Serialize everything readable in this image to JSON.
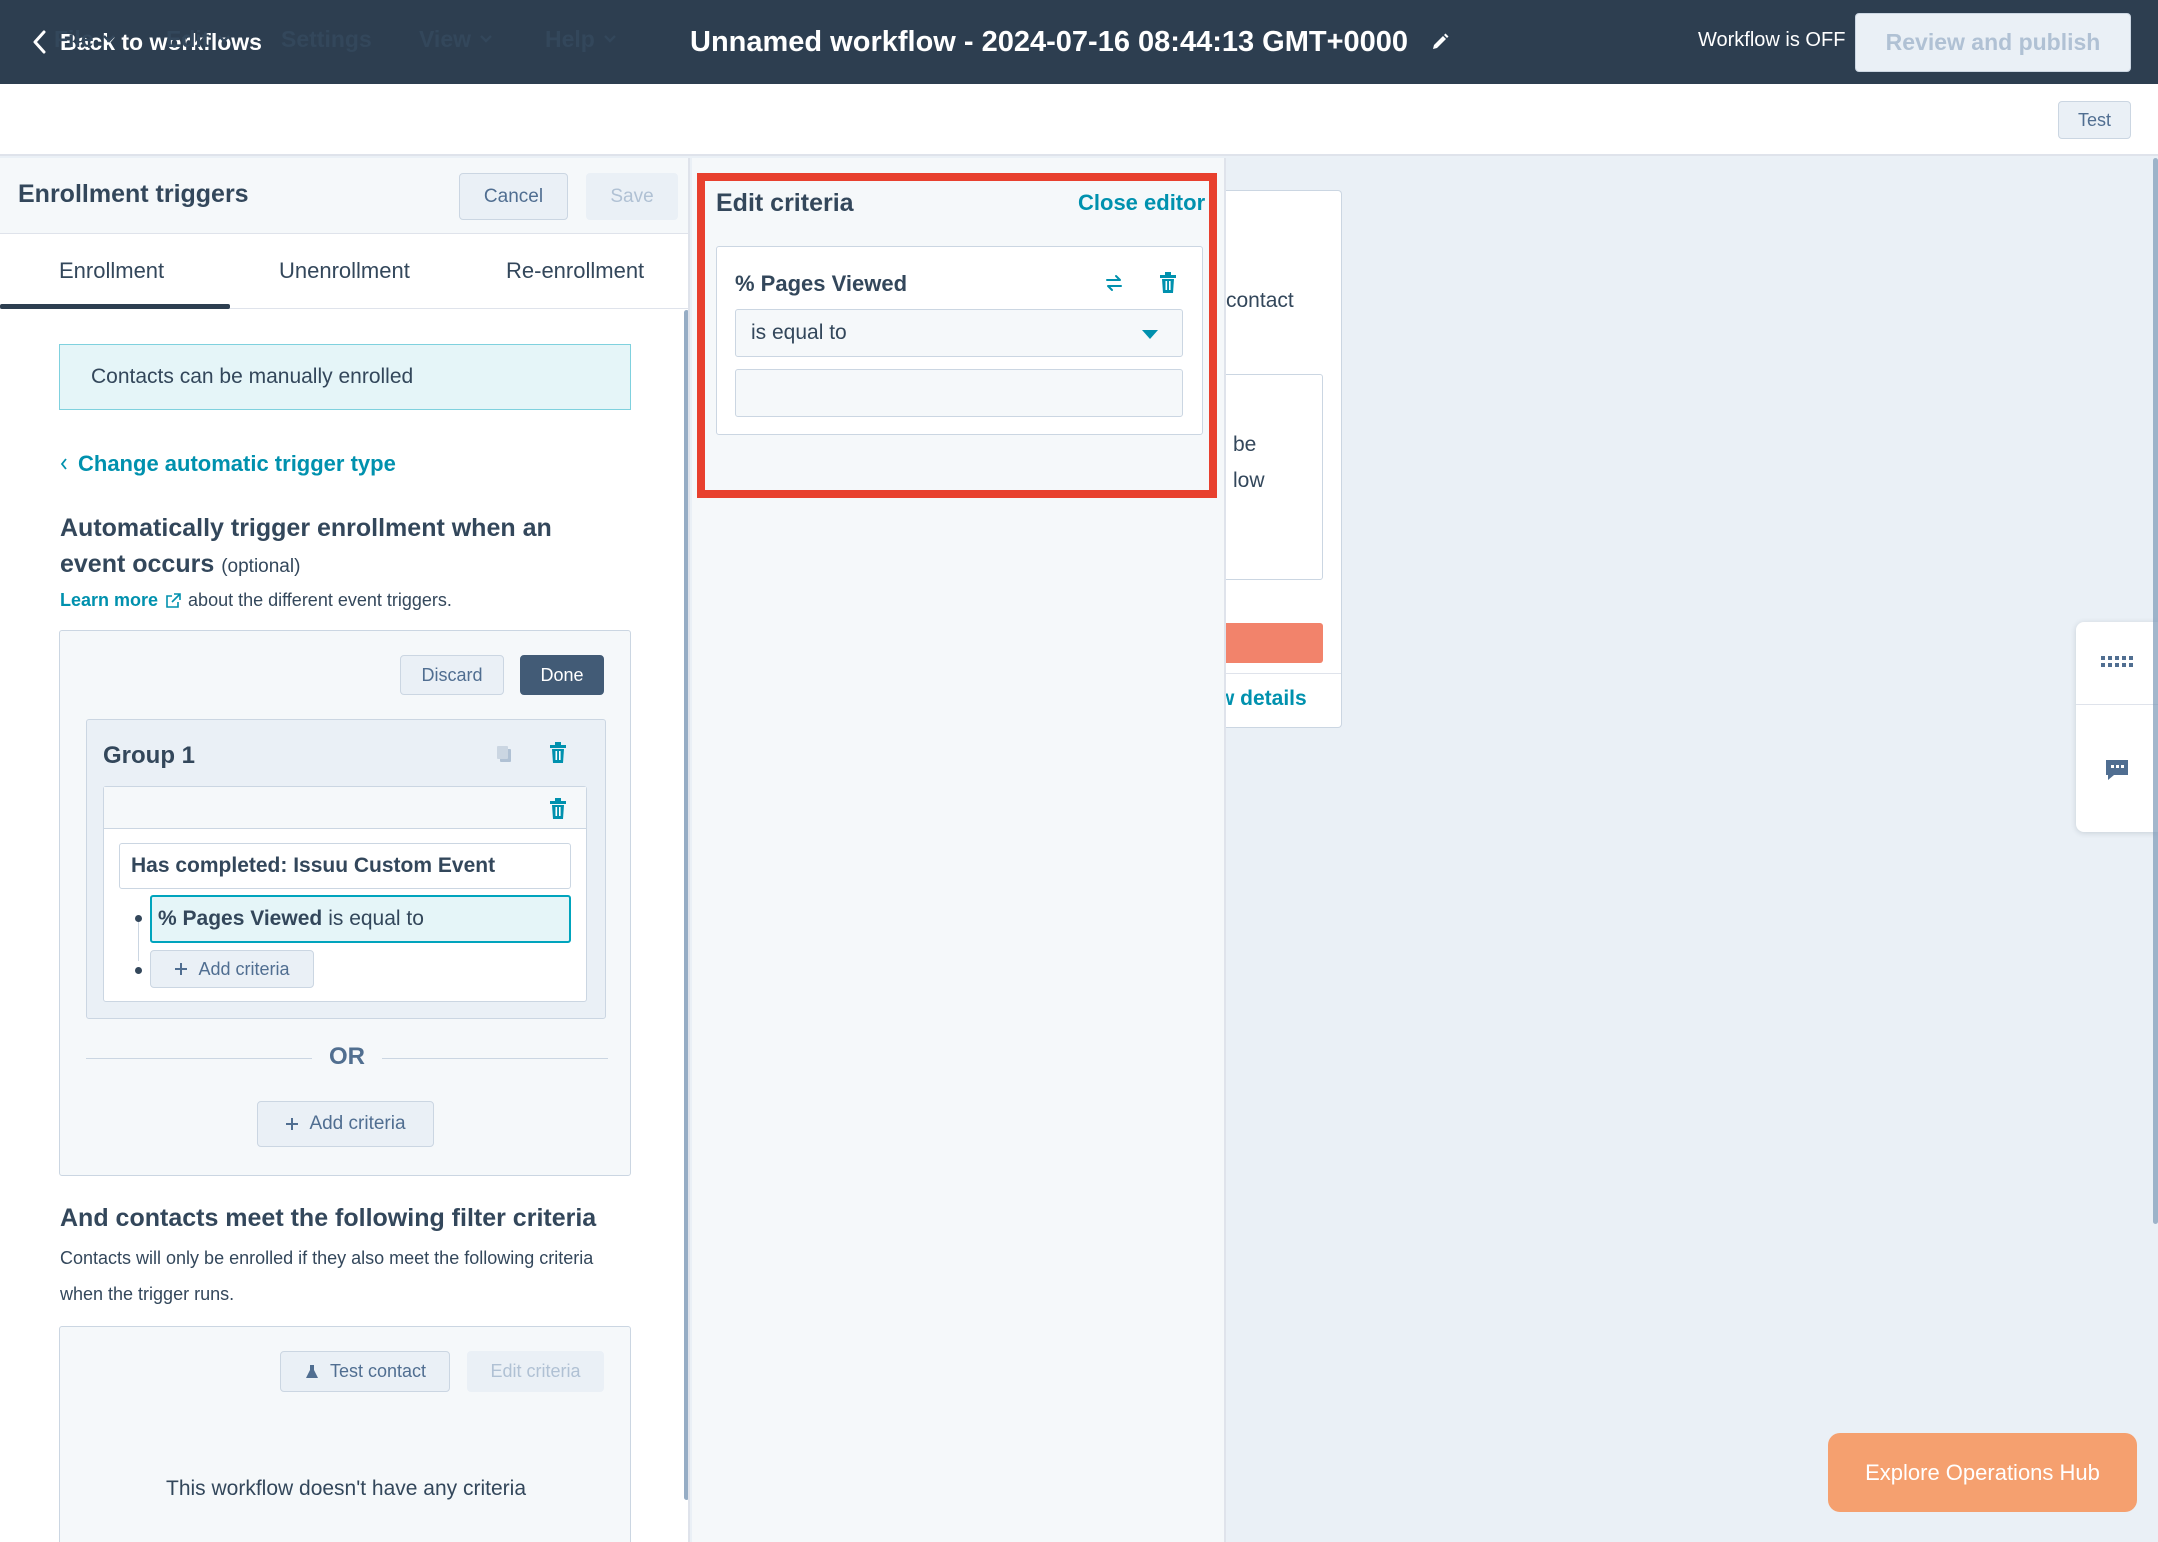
{
  "topbar": {
    "back_label": "Back to workflows",
    "workflow_title": "Unnamed workflow - 2024-07-16 08:44:13 GMT+0000",
    "status": "Workflow is OFF",
    "publish_label": "Review and publish"
  },
  "menu": {
    "items": [
      "File",
      "Edit",
      "Settings",
      "View",
      "Help"
    ],
    "test_label": "Test"
  },
  "left_panel": {
    "title": "Enrollment triggers",
    "cancel_label": "Cancel",
    "save_label": "Save",
    "tabs": [
      "Enrollment",
      "Unenrollment",
      "Re-enrollment"
    ],
    "manual_notice": "Contacts can be manually enrolled",
    "change_trigger_link": "Change automatic trigger type",
    "auto_heading": "Automatically trigger enrollment when an event occurs",
    "auto_optional": "(optional)",
    "learn_more_link": "Learn more",
    "learn_more_rest": "about the different event triggers.",
    "discard_label": "Discard",
    "done_label": "Done",
    "group_title": "Group 1",
    "completed_event": "Has completed: Issuu Custom Event",
    "criteria_property": "% Pages Viewed",
    "criteria_operator": "is equal to",
    "add_criteria_label": "Add criteria",
    "or_label": "OR",
    "filter_heading": "And contacts meet the following filter criteria",
    "filter_desc": "Contacts will only be enrolled if they also meet the following criteria when the trigger runs.",
    "test_contact_label": "Test contact",
    "edit_criteria_label": "Edit criteria",
    "no_criteria": "This workflow doesn't have any criteria"
  },
  "edit_panel": {
    "title": "Edit criteria",
    "close_label": "Close editor",
    "property": "% Pages Viewed",
    "operator": "is equal to",
    "value": ""
  },
  "canvas": {
    "card_text1": "contact",
    "card_text2a": "be",
    "card_text2b": "low",
    "card_link": "w details",
    "explore_label": "Explore Operations Hub"
  },
  "colors": {
    "topbar": "#2d3e50",
    "link": "#0091ae",
    "highlight": "#e8402e",
    "explore": "#f5a06f"
  },
  "icons": [
    "chevron-left-icon",
    "pencil-icon",
    "chevron-down-icon",
    "external-link-icon",
    "copy-icon",
    "trash-icon",
    "plus-icon",
    "swap-icon",
    "caret-down-icon",
    "flask-icon",
    "keypad-icon",
    "chat-icon"
  ]
}
